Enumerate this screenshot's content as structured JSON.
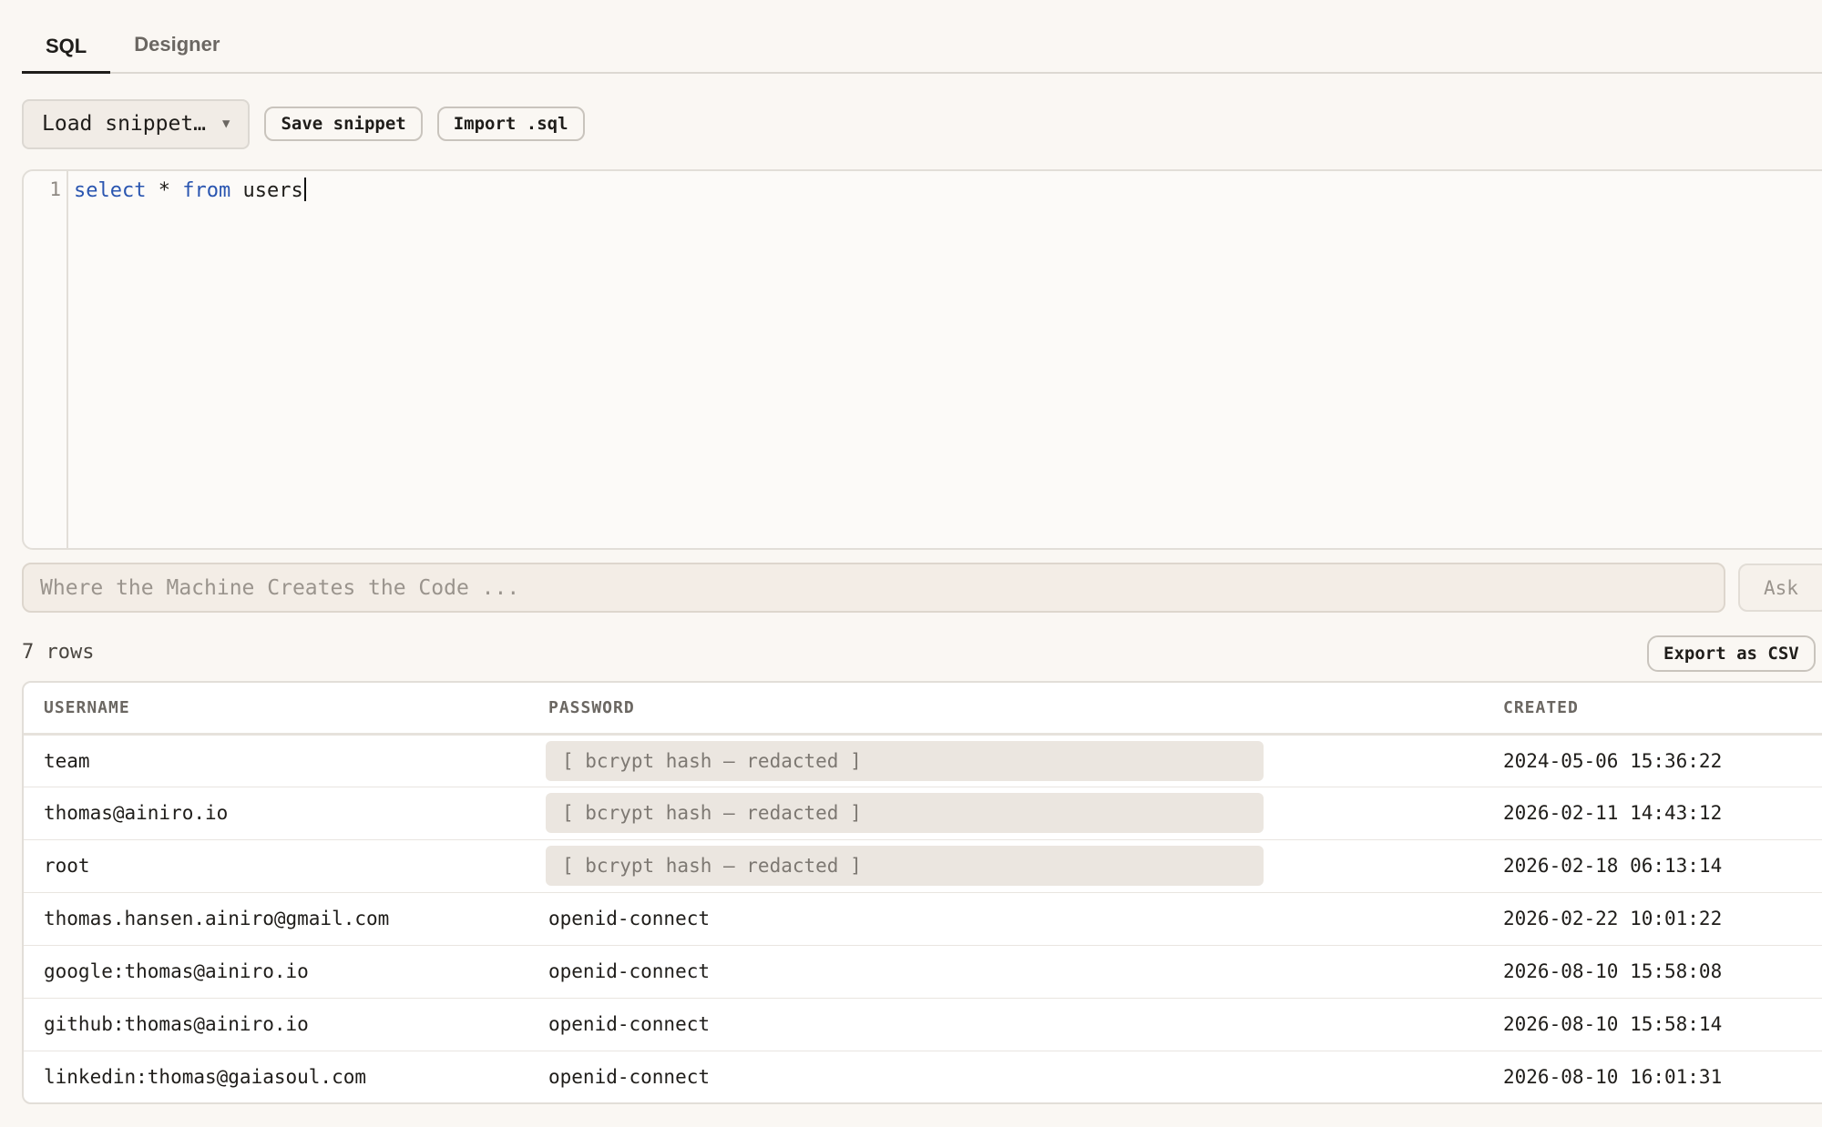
{
  "tabs": [
    {
      "label": "SQL",
      "active": true
    },
    {
      "label": "Designer",
      "active": false
    }
  ],
  "toolbar": {
    "load_snippet": "Load snippet…",
    "save_snippet": "Save snippet",
    "import_sql": "Import .sql"
  },
  "editor": {
    "line_number": "1",
    "kw_select": "select",
    "star": " * ",
    "kw_from": "from",
    "table_name": " users"
  },
  "ask": {
    "placeholder": "Where the Machine Creates the Code ...",
    "button": "Ask"
  },
  "results": {
    "row_count": "7 rows",
    "export_label": "Export as CSV",
    "columns": [
      "USERNAME",
      "PASSWORD",
      "CREATED"
    ],
    "rows": [
      {
        "username": "team",
        "password": "[ bcrypt hash — redacted ]",
        "redacted": true,
        "created": "2024-05-06 15:36:22"
      },
      {
        "username": "thomas@ainiro.io",
        "password": "[ bcrypt hash — redacted ]",
        "redacted": true,
        "created": "2026-02-11 14:43:12"
      },
      {
        "username": "root",
        "password": "[ bcrypt hash — redacted ]",
        "redacted": true,
        "created": "2026-02-18 06:13:14"
      },
      {
        "username": "thomas.hansen.ainiro@gmail.com",
        "password": "openid-connect",
        "redacted": false,
        "created": "2026-02-22 10:01:22"
      },
      {
        "username": "google:thomas@ainiro.io",
        "password": "openid-connect",
        "redacted": false,
        "created": "2026-08-10 15:58:08"
      },
      {
        "username": "github:thomas@ainiro.io",
        "password": "openid-connect",
        "redacted": false,
        "created": "2026-08-10 15:58:14"
      },
      {
        "username": "linkedin:thomas@gaiasoul.com",
        "password": "openid-connect",
        "redacted": false,
        "created": "2026-08-10 16:01:31"
      }
    ]
  }
}
